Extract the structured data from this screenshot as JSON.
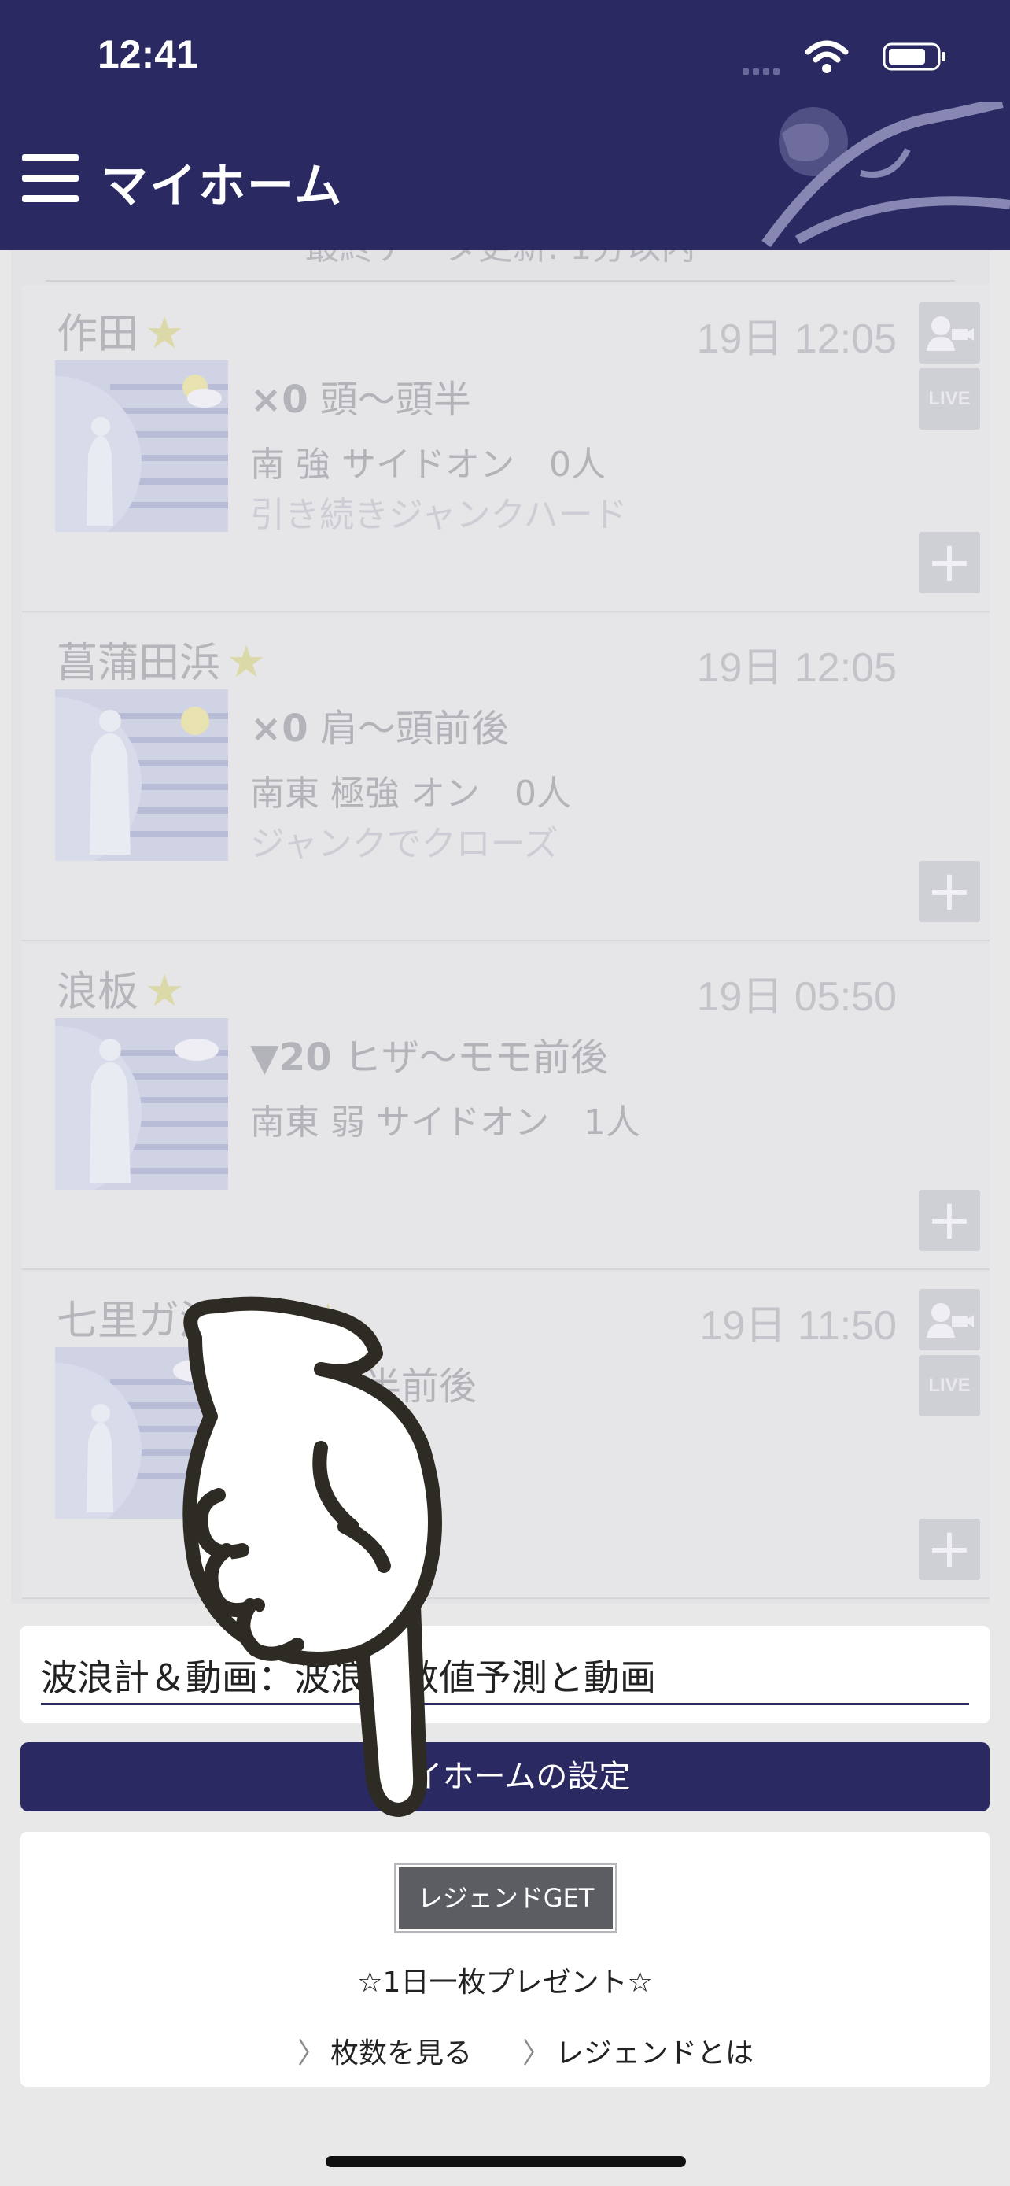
{
  "status_bar": {
    "time": "12:41"
  },
  "header": {
    "title": "マイホーム"
  },
  "list": {
    "last_updated": "最終データ更新: 1分以内",
    "spots": [
      {
        "name": "作田",
        "time": "19日 12:05",
        "size_value": "×0",
        "size_text": "頭〜頭半",
        "wind": "南 強 サイドオン　0人",
        "condition": "引き続きジャンクハード",
        "has_camera": true,
        "has_live": true,
        "weather_icon": "sun-cloud-icon"
      },
      {
        "name": "菖蒲田浜",
        "time": "19日 12:05",
        "size_value": "×0",
        "size_text": "肩〜頭前後",
        "wind": "南東 極強 オン　0人",
        "condition": "ジャンクでクローズ",
        "has_camera": false,
        "has_live": false,
        "weather_icon": "sun-cloud-icon"
      },
      {
        "name": "浪板",
        "time": "19日 05:50",
        "size_value": "▼20",
        "size_text": "ヒザ〜モモ前後",
        "wind": "南東 弱 サイドオン　1人",
        "condition": "",
        "has_camera": false,
        "has_live": false,
        "weather_icon": "cloud-icon"
      },
      {
        "name": "七里ガ浜下馬",
        "time": "19日 11:50",
        "size_value": "",
        "size_text": "ま〜頭半前後",
        "wind": "0人",
        "condition": "",
        "has_camera": true,
        "has_live": true,
        "weather_icon": "rain-cloud-icon"
      }
    ],
    "live_label": "LIVE",
    "add_label": "+"
  },
  "forecast_select": {
    "value": "波浪計＆動画：波浪計数値予測と動画"
  },
  "settings_button": {
    "label": "マイホームの設定"
  },
  "legend": {
    "get_label": "レジェンドGET",
    "present_text": "☆1日一枚プレゼント☆",
    "link_count": "枚数を見る",
    "link_about": "レジェンドとは"
  },
  "colors": {
    "header_bg": "#2b2961",
    "accent": "#2b2961",
    "star": "#dcd9a8"
  }
}
